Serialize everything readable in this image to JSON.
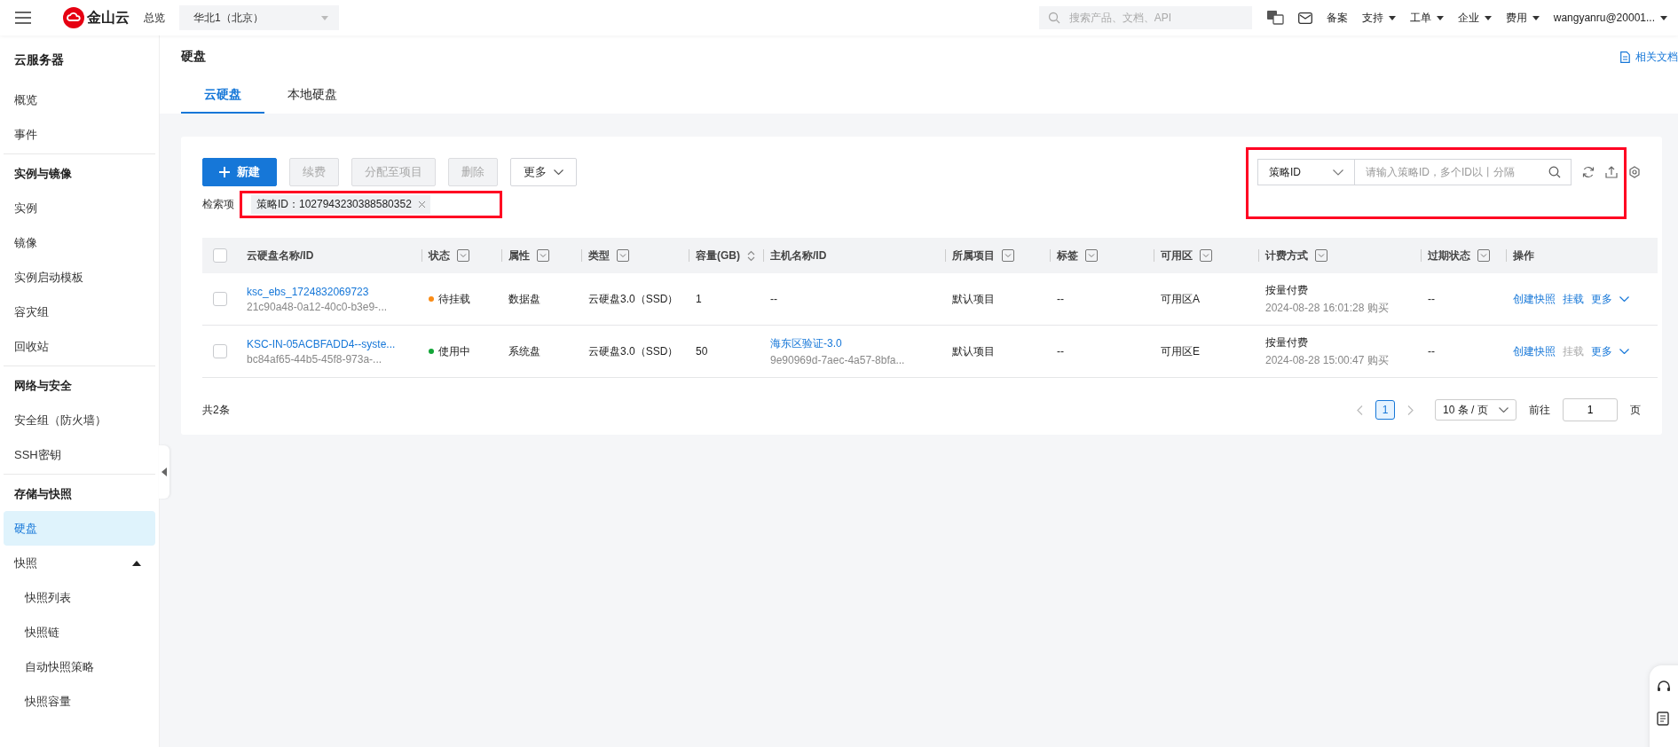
{
  "topbar": {
    "logo": "金山云",
    "overview": "总览",
    "region": "华北1（北京）",
    "search_placeholder": "搜索产品、文档、API",
    "menus": [
      {
        "label": "备案",
        "kind": "link"
      },
      {
        "label": "支持",
        "kind": "dropdown"
      },
      {
        "label": "工单",
        "kind": "dropdown"
      },
      {
        "label": "企业",
        "kind": "dropdown"
      },
      {
        "label": "费用",
        "kind": "dropdown"
      }
    ],
    "user": "wangyanru@20001..."
  },
  "sidebar": {
    "title": "云服务器",
    "sections": [
      {
        "items": [
          {
            "label": "概览",
            "selected": false
          },
          {
            "label": "事件",
            "selected": false
          }
        ]
      },
      {
        "heading": "实例与镜像",
        "items": [
          {
            "label": "实例",
            "selected": false
          },
          {
            "label": "镜像",
            "selected": false
          },
          {
            "label": "实例启动模板",
            "selected": false
          },
          {
            "label": "容灾组",
            "selected": false
          },
          {
            "label": "回收站",
            "selected": false
          }
        ]
      },
      {
        "heading": "网络与安全",
        "items": [
          {
            "label": "安全组（防火墙）",
            "selected": false
          },
          {
            "label": "SSH密钥",
            "selected": false
          }
        ]
      },
      {
        "heading": "存储与快照",
        "items": [
          {
            "label": "硬盘",
            "selected": true
          },
          {
            "label": "快照",
            "selected": false,
            "expanded": true,
            "children": [
              {
                "label": "快照列表",
                "selected": false
              },
              {
                "label": "快照链",
                "selected": false
              },
              {
                "label": "自动快照策略",
                "selected": false
              },
              {
                "label": "快照容量",
                "selected": false
              }
            ]
          }
        ]
      }
    ]
  },
  "page": {
    "title": "硬盘",
    "doc_link": "相关文档",
    "tabs": [
      {
        "label": "云硬盘",
        "selected": true
      },
      {
        "label": "本地硬盘",
        "selected": false
      }
    ]
  },
  "toolbar": {
    "buttons": [
      {
        "label": "新建",
        "kind": "primary",
        "disabled": false
      },
      {
        "label": "续费",
        "kind": "plain",
        "disabled": true
      },
      {
        "label": "分配至项目",
        "kind": "plain",
        "disabled": true
      },
      {
        "label": "删除",
        "kind": "plain",
        "disabled": true
      },
      {
        "label": "更多",
        "kind": "dropdown",
        "disabled": false
      }
    ],
    "search_type": "策略ID",
    "search_placeholder": "请输入策略ID，多个ID以丨分隔"
  },
  "filters": {
    "label": "检索项",
    "tags": [
      "策略ID：1027943230388580352"
    ]
  },
  "table": {
    "all_checked": false,
    "columns": [
      {
        "label": "云硬盘名称/ID",
        "kind": "plain"
      },
      {
        "label": "状态",
        "kind": "filter"
      },
      {
        "label": "属性",
        "kind": "filter"
      },
      {
        "label": "类型",
        "kind": "filter"
      },
      {
        "label": "容量(GB)",
        "kind": "sort"
      },
      {
        "label": "主机名称/ID",
        "kind": "plain"
      },
      {
        "label": "所属项目",
        "kind": "filter"
      },
      {
        "label": "标签",
        "kind": "filter"
      },
      {
        "label": "可用区",
        "kind": "filter"
      },
      {
        "label": "计费方式",
        "kind": "filter"
      },
      {
        "label": "过期状态",
        "kind": "filter"
      },
      {
        "label": "操作",
        "kind": "plain"
      }
    ],
    "rows": [
      {
        "checked": false,
        "name": "ksc_ebs_1724832069723",
        "id": "21c90a48-0a12-40c0-b3e9-...",
        "status": "待挂载",
        "color": "#fa8c16",
        "attribute": "数据盘",
        "type": "云硬盘3.0（SSD）",
        "capacity": "1",
        "host_name": "--",
        "host_id": "",
        "project": "默认项目",
        "tags": "--",
        "zone": "可用区A",
        "billing": "按量付费",
        "purchased": "2024-08-28 16:01:28 购买",
        "expiry": "--",
        "actions": [
          {
            "label": "创建快照",
            "kind": "link",
            "disabled": false
          },
          {
            "label": "挂载",
            "kind": "link",
            "disabled": false
          },
          {
            "label": "更多",
            "kind": "menu",
            "disabled": false
          }
        ]
      },
      {
        "checked": false,
        "name": "KSC-IN-05ACBFADD4--syste...",
        "id": "bc84af65-44b5-45f8-973a-...",
        "status": "使用中",
        "color": "#13a538",
        "attribute": "系统盘",
        "type": "云硬盘3.0（SSD）",
        "capacity": "50",
        "host_name": "海东区验证-3.0",
        "host_id": "9e90969d-7aec-4a57-8bfa...",
        "project": "默认项目",
        "tags": "--",
        "zone": "可用区E",
        "billing": "按量付费",
        "purchased": "2024-08-28 15:00:47 购买",
        "expiry": "--",
        "actions": [
          {
            "label": "创建快照",
            "kind": "link",
            "disabled": false
          },
          {
            "label": "挂载",
            "kind": "link",
            "disabled": true
          },
          {
            "label": "更多",
            "kind": "menu",
            "disabled": false
          }
        ]
      }
    ]
  },
  "pagination": {
    "total": "共2条",
    "pages": [
      {
        "label": "1",
        "selected": true
      }
    ],
    "page_size": "10 条 / 页",
    "goto": "前往",
    "goto_value": "1",
    "goto_unit": "页"
  }
}
